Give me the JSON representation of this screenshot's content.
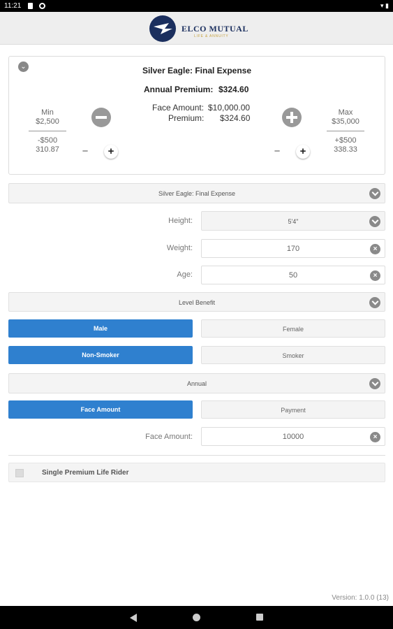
{
  "status_bar": {
    "time": "11:21"
  },
  "header": {
    "brand": "ELCO MUTUAL",
    "brand_sub": "LIFE & ANNUITY"
  },
  "summary": {
    "title": "Silver Eagle: Final Expense",
    "annual_premium_label": "Annual Premium:",
    "annual_premium_value": "$324.60",
    "face_amount_label": "Face Amount:",
    "face_amount_value": "$10,000.00",
    "premium_label": "Premium:",
    "premium_value": "$324.60",
    "min_label": "Min",
    "min_value": "$2,500",
    "min_step": "-$500",
    "min_step_premium": "310.87",
    "max_label": "Max",
    "max_value": "$35,000",
    "max_step": "+$500",
    "max_step_premium": "338.33",
    "minus_symbol": "−",
    "plus_symbol": "+"
  },
  "form": {
    "product": "Silver Eagle: Final Expense",
    "height_label": "Height:",
    "height_value": "5'4\"",
    "weight_label": "Weight:",
    "weight_value": "170",
    "age_label": "Age:",
    "age_value": "50",
    "benefit": "Level Benefit",
    "gender_options": [
      "Male",
      "Female"
    ],
    "tobacco_options": [
      "Non-Smoker",
      "Smoker"
    ],
    "mode": "Annual",
    "calc_options": [
      "Face Amount",
      "Payment"
    ],
    "face_amount_label": "Face Amount:",
    "face_amount_value": "10000",
    "rider_label": "Single Premium Life Rider"
  },
  "footer": {
    "version": "Version: 1.0.0 (13)"
  },
  "colors": {
    "accent": "#2f80cf",
    "brand_navy": "#1b2f5e",
    "brand_gold": "#c7a340"
  }
}
